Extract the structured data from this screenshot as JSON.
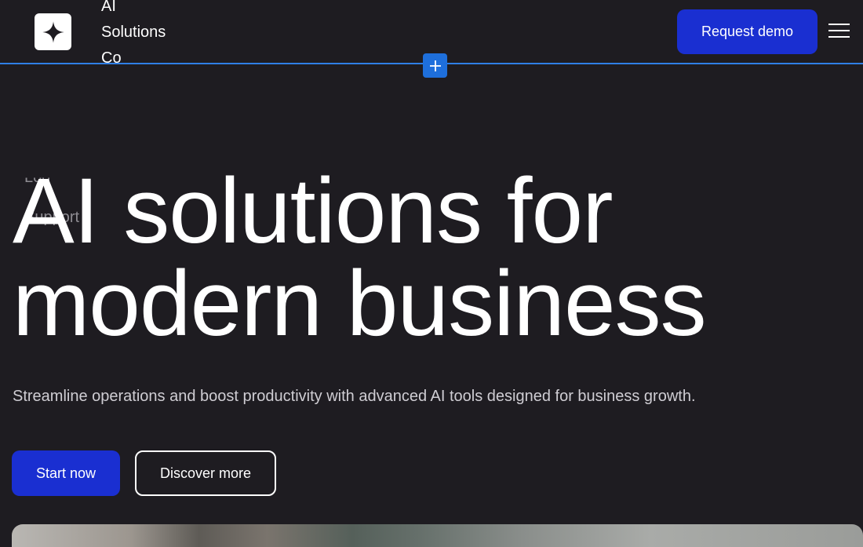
{
  "header": {
    "brand_lines": [
      "AI",
      "Solutions",
      "Co"
    ],
    "logo_icon": "sparkle-icon",
    "request_demo_label": "Request demo",
    "menu_icon": "hamburger-menu-icon"
  },
  "editor": {
    "add_section_icon": "plus-icon",
    "accent_color": "#2f7fe6"
  },
  "ghost_menu": {
    "item_top": "Log",
    "item_support": "Support"
  },
  "hero": {
    "title_lines": [
      "AI solutions for",
      "modern business"
    ],
    "subtitle": "Streamline operations and boost productivity with advanced AI tools designed for business growth.",
    "primary_cta": "Start now",
    "secondary_cta": "Discover more"
  },
  "colors": {
    "background": "#1e1c21",
    "primary_button": "#1a2fd1",
    "text": "#ffffff"
  }
}
